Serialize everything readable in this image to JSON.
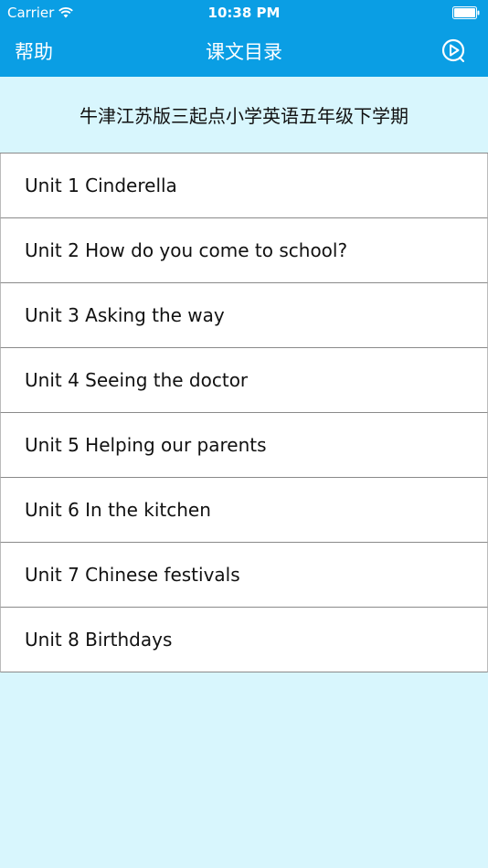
{
  "status_bar": {
    "carrier": "Carrier",
    "time": "10:38 PM"
  },
  "nav": {
    "left_label": "帮助",
    "title": "课文目录",
    "right_icon": "play-circle-icon"
  },
  "book_title": "牛津江苏版三起点小学英语五年级下学期",
  "units": [
    "Unit 1 Cinderella",
    "Unit 2 How do you come to school?",
    "Unit 3 Asking the way",
    "Unit 4 Seeing the doctor",
    "Unit 5 Helping our parents",
    "Unit 6 In the kitchen",
    "Unit 7 Chinese festivals",
    "Unit 8 Birthdays"
  ],
  "colors": {
    "header": "#0a9ee4",
    "background": "#d8f6fd"
  }
}
